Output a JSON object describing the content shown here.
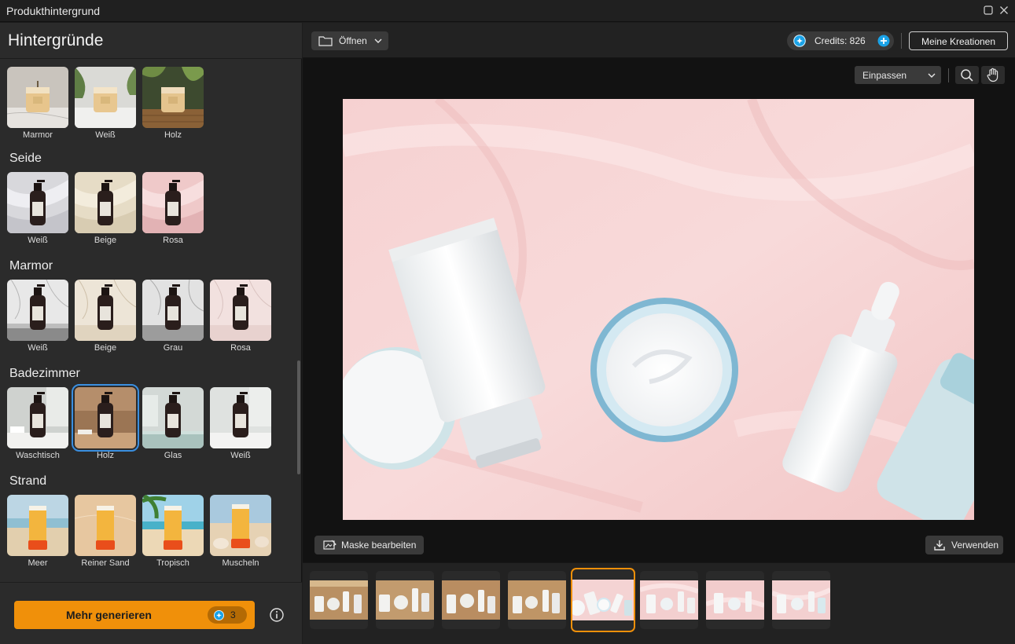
{
  "window": {
    "title": "Produkthintergrund"
  },
  "sidebar": {
    "title": "Hintergründe",
    "top_row_labels": [
      "Marmor",
      "Weiß",
      "Holz"
    ],
    "categories": [
      {
        "title": "Seide",
        "items": [
          "Weiß",
          "Beige",
          "Rosa"
        ]
      },
      {
        "title": "Marmor",
        "items": [
          "Weiß",
          "Beige",
          "Grau",
          "Rosa"
        ]
      },
      {
        "title": "Badezimmer",
        "items": [
          "Waschtisch",
          "Holz",
          "Glas",
          "Weiß"
        ]
      },
      {
        "title": "Strand",
        "items": [
          "Meer",
          "Reiner Sand",
          "Tropisch",
          "Muscheln"
        ]
      }
    ],
    "selected": "Badezimmer/Holz",
    "generate": {
      "label": "Mehr generieren",
      "cost": "3"
    }
  },
  "toolbar": {
    "open_label": "Öffnen",
    "credits_label": "Credits: 826",
    "my_creations_label": "Meine Kreationen",
    "fit_label": "Einpassen"
  },
  "canvas": {
    "mask_label": "Maske bearbeiten",
    "use_label": "Verwenden"
  },
  "filmstrip": {
    "count": 8,
    "selected_index": 4
  },
  "colors": {
    "accent": "#f0900a",
    "select": "#3a8fe0",
    "credit": "#1aa3e8"
  },
  "icons": {
    "open": "folder-icon",
    "credit": "credit-coin-icon",
    "add": "plus-icon",
    "zoom": "search-icon",
    "pan": "hand-icon",
    "mask": "mask-edit-icon",
    "download": "download-icon",
    "info": "info-icon"
  }
}
